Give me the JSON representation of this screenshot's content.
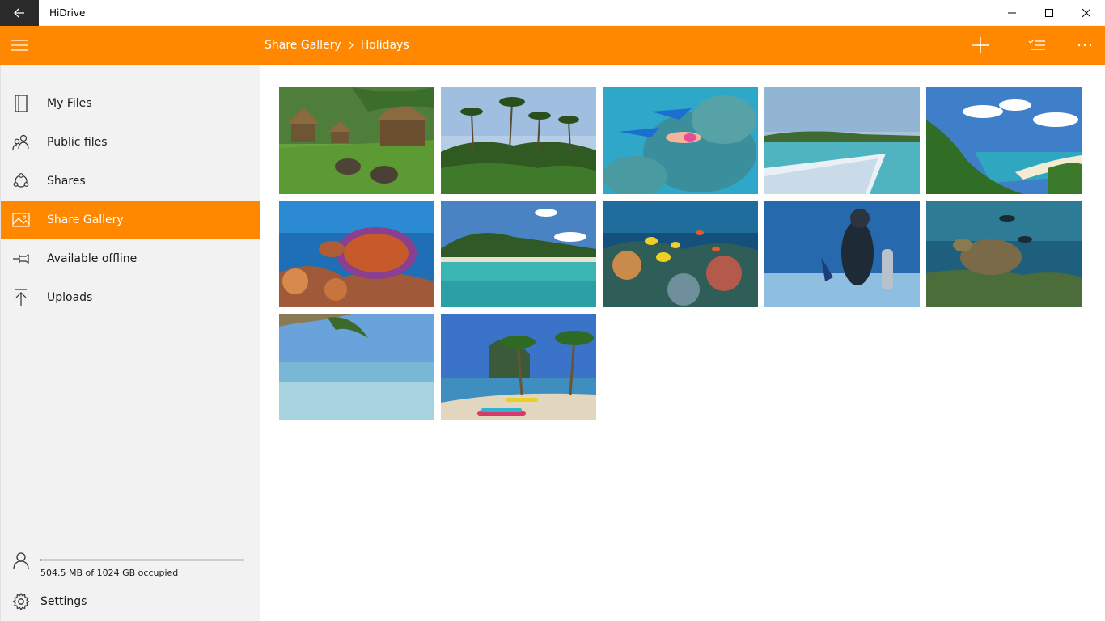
{
  "window": {
    "title": "HiDrive",
    "back_icon": "arrow-left-icon",
    "controls": [
      "minimize-icon",
      "maximize-icon",
      "close-icon"
    ]
  },
  "header": {
    "background": "#ff8800",
    "breadcrumb": [
      "Share Gallery",
      "Holidays"
    ],
    "actions": [
      "add-icon",
      "select-list-icon",
      "more-icon"
    ]
  },
  "sidebar": {
    "items": [
      {
        "label": "My Files",
        "icon": "file-icon"
      },
      {
        "label": "Public files",
        "icon": "people-icon"
      },
      {
        "label": "Shares",
        "icon": "share-icon"
      },
      {
        "label": "Share Gallery",
        "icon": "image-icon",
        "active": true
      },
      {
        "label": "Available offline",
        "icon": "pin-icon"
      },
      {
        "label": "Uploads",
        "icon": "upload-icon"
      }
    ],
    "storage": {
      "text": "504.5 MB of 1024 GB occupied",
      "fraction_used": 0.0005
    },
    "settings_label": "Settings"
  },
  "gallery": {
    "photos": [
      "huts-and-tortoises",
      "palm-trees-forest",
      "snorkeler-reef",
      "boat-bow-island",
      "tropical-bay-beach",
      "sea-turtle-coral",
      "lagoon-shore",
      "reef-fish",
      "scuba-diver",
      "turtle-and-divers",
      "palm-over-sea",
      "beach-palms-kayaks"
    ]
  }
}
